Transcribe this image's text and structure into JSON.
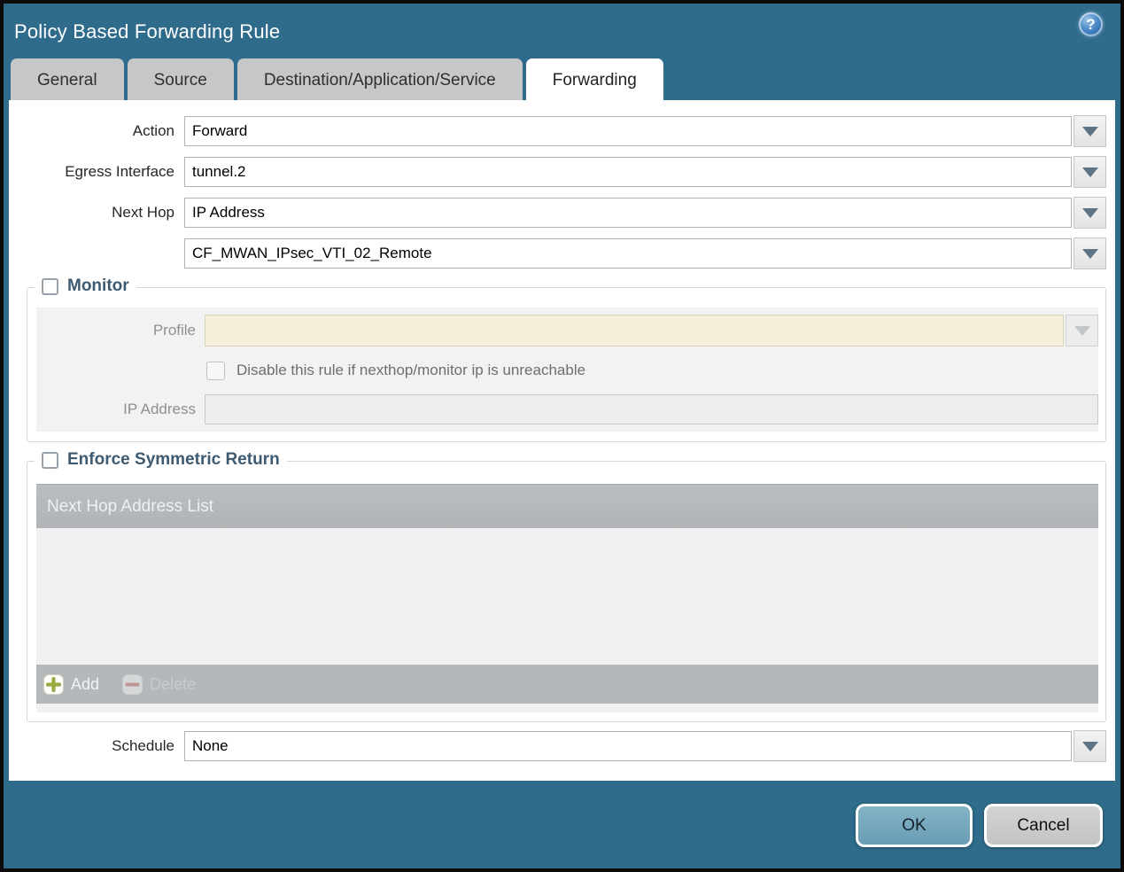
{
  "window": {
    "title": "Policy Based Forwarding Rule",
    "help_glyph": "?"
  },
  "tabs": [
    {
      "label": "General"
    },
    {
      "label": "Source"
    },
    {
      "label": "Destination/Application/Service"
    },
    {
      "label": "Forwarding"
    }
  ],
  "active_tab": "Forwarding",
  "form": {
    "action_label": "Action",
    "action_value": "Forward",
    "egress_label": "Egress Interface",
    "egress_value": "tunnel.2",
    "next_hop_label": "Next Hop",
    "next_hop_value": "IP Address",
    "next_hop_address_value": "CF_MWAN_IPsec_VTI_02_Remote",
    "schedule_label": "Schedule",
    "schedule_value": "None"
  },
  "monitor": {
    "title": "Monitor",
    "checked": false,
    "profile_label": "Profile",
    "profile_value": "",
    "disable_rule_label": "Disable this rule if nexthop/monitor ip is unreachable",
    "disable_rule_checked": false,
    "ip_address_label": "IP Address",
    "ip_address_value": ""
  },
  "enforce": {
    "title": "Enforce Symmetric Return",
    "checked": false,
    "table_header": "Next Hop Address List",
    "rows": [],
    "add_label": "Add",
    "delete_label": "Delete"
  },
  "buttons": {
    "ok": "OK",
    "cancel": "Cancel"
  },
  "colors": {
    "titlebar": "#2f6b8a",
    "ok_button": "#74a8bd",
    "table_header": "#b4b8bb",
    "disabled_profile_field": "#f5eedb"
  }
}
